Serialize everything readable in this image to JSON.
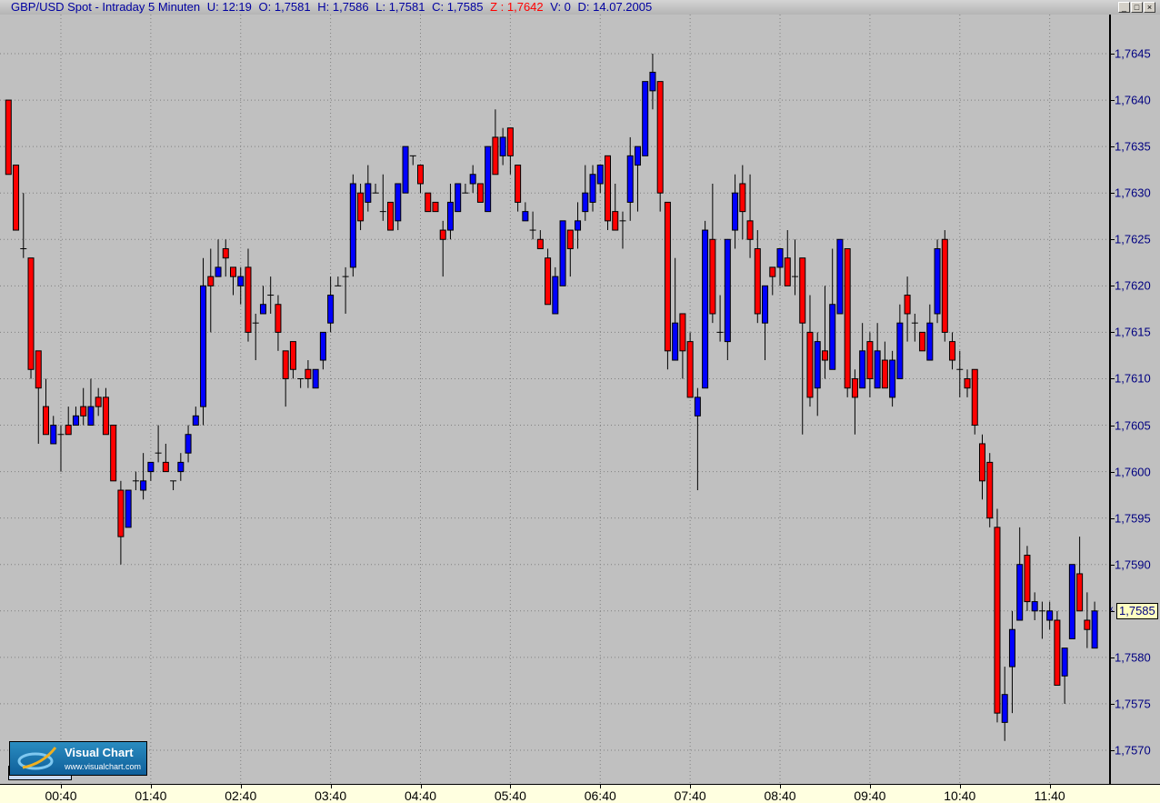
{
  "title_bar": {
    "instrument": "GBP/USD Spot - Intraday 5 Minuten",
    "update": "U: 12:19",
    "open": "O: 1,7581",
    "high": "H: 1,7586",
    "low": "L: 1,7581",
    "close": "C: 1,7585",
    "z": "Z : 1,7642",
    "volume": "V: 0",
    "date": "D: 14.07.2005",
    "minimize": "_",
    "maximize": "□",
    "close_btn": "×"
  },
  "current_price_label": "1,7585",
  "logo": {
    "name": "Visual Chart",
    "url": "www.visualchart.com"
  },
  "colors": {
    "up": "#0000ff",
    "down": "#ff0000",
    "background": "#c0c0c0",
    "axis_text": "#000080",
    "grid": "#808080"
  },
  "chart_data": {
    "type": "candlestick",
    "title": "GBP/USD Spot - Intraday 5 Minuten",
    "ylim": [
      1.75655,
      1.76495
    ],
    "grid": true,
    "y_ticks": [
      {
        "label": "1,7645",
        "value": 1.7645
      },
      {
        "label": "1,7640",
        "value": 1.764
      },
      {
        "label": "1,7635",
        "value": 1.7635
      },
      {
        "label": "1,7630",
        "value": 1.763
      },
      {
        "label": "1,7625",
        "value": 1.7625
      },
      {
        "label": "1,7620",
        "value": 1.762
      },
      {
        "label": "1,7615",
        "value": 1.7615
      },
      {
        "label": "1,7610",
        "value": 1.761
      },
      {
        "label": "1,7605",
        "value": 1.7605
      },
      {
        "label": "1,7600",
        "value": 1.76
      },
      {
        "label": "1,7595",
        "value": 1.7595
      },
      {
        "label": "1,7590",
        "value": 1.759
      },
      {
        "label": "1,7585",
        "value": 1.7585
      },
      {
        "label": "1,7580",
        "value": 1.758
      },
      {
        "label": "1,7575",
        "value": 1.7575
      },
      {
        "label": "1,7570",
        "value": 1.757
      }
    ],
    "x_ticks": [
      {
        "label": "00:40",
        "index": 7
      },
      {
        "label": "01:40",
        "index": 19
      },
      {
        "label": "02:40",
        "index": 31
      },
      {
        "label": "03:40",
        "index": 43
      },
      {
        "label": "04:40",
        "index": 55
      },
      {
        "label": "05:40",
        "index": 67
      },
      {
        "label": "06:40",
        "index": 79
      },
      {
        "label": "07:40",
        "index": 91
      },
      {
        "label": "08:40",
        "index": 103
      },
      {
        "label": "09:40",
        "index": 115
      },
      {
        "label": "10:40",
        "index": 127
      },
      {
        "label": "11:40",
        "index": 139
      }
    ],
    "ohlc_fields": [
      "open",
      "high",
      "low",
      "close"
    ],
    "ohlc": [
      [
        1.764,
        1.764,
        1.7632,
        1.7632
      ],
      [
        1.7633,
        1.7633,
        1.7626,
        1.7626
      ],
      [
        1.7624,
        1.763,
        1.7623,
        1.7624
      ],
      [
        1.7623,
        1.7623,
        1.761,
        1.7611
      ],
      [
        1.7613,
        1.7613,
        1.7603,
        1.7609
      ],
      [
        1.7607,
        1.761,
        1.7604,
        1.7604
      ],
      [
        1.7603,
        1.7606,
        1.7603,
        1.7605
      ],
      [
        1.7604,
        1.7605,
        1.76,
        1.7604
      ],
      [
        1.7605,
        1.7607,
        1.7604,
        1.7604
      ],
      [
        1.7605,
        1.7607,
        1.7605,
        1.7606
      ],
      [
        1.7607,
        1.7609,
        1.7605,
        1.7606
      ],
      [
        1.7605,
        1.761,
        1.7605,
        1.7607
      ],
      [
        1.7608,
        1.7609,
        1.7606,
        1.7607
      ],
      [
        1.7608,
        1.7609,
        1.7604,
        1.7604
      ],
      [
        1.7605,
        1.7605,
        1.7599,
        1.7599
      ],
      [
        1.7598,
        1.7599,
        1.759,
        1.7593
      ],
      [
        1.7594,
        1.7598,
        1.7594,
        1.7598
      ],
      [
        1.7599,
        1.76,
        1.7598,
        1.7599
      ],
      [
        1.7598,
        1.7602,
        1.7597,
        1.7599
      ],
      [
        1.76,
        1.7601,
        1.7599,
        1.7601
      ],
      [
        1.7602,
        1.7605,
        1.7601,
        1.7602
      ],
      [
        1.7601,
        1.7603,
        1.76,
        1.76
      ],
      [
        1.7599,
        1.7599,
        1.7598,
        1.7599
      ],
      [
        1.76,
        1.7602,
        1.7599,
        1.7601
      ],
      [
        1.7602,
        1.7605,
        1.7601,
        1.7604
      ],
      [
        1.7605,
        1.7607,
        1.7605,
        1.7606
      ],
      [
        1.7607,
        1.7623,
        1.7605,
        1.762
      ],
      [
        1.7621,
        1.7624,
        1.7615,
        1.762
      ],
      [
        1.7621,
        1.7625,
        1.7621,
        1.7622
      ],
      [
        1.7624,
        1.7625,
        1.7621,
        1.7623
      ],
      [
        1.7622,
        1.7622,
        1.7619,
        1.7621
      ],
      [
        1.762,
        1.7622,
        1.7618,
        1.7621
      ],
      [
        1.7622,
        1.7624,
        1.7614,
        1.7615
      ],
      [
        1.7616,
        1.7617,
        1.7612,
        1.7616
      ],
      [
        1.7617,
        1.762,
        1.7617,
        1.7618
      ],
      [
        1.7619,
        1.7621,
        1.7617,
        1.7619
      ],
      [
        1.7618,
        1.7619,
        1.7613,
        1.7615
      ],
      [
        1.7613,
        1.7613,
        1.7607,
        1.761
      ],
      [
        1.7614,
        1.7614,
        1.761,
        1.7611
      ],
      [
        1.761,
        1.761,
        1.7609,
        1.761
      ],
      [
        1.7611,
        1.7612,
        1.7609,
        1.761
      ],
      [
        1.7609,
        1.7611,
        1.7609,
        1.7611
      ],
      [
        1.7612,
        1.7615,
        1.7611,
        1.7615
      ],
      [
        1.7616,
        1.7621,
        1.7615,
        1.7619
      ],
      [
        1.762,
        1.7621,
        1.762,
        1.762
      ],
      [
        1.7621,
        1.7622,
        1.7617,
        1.7621
      ],
      [
        1.7622,
        1.7632,
        1.7621,
        1.7631
      ],
      [
        1.763,
        1.7631,
        1.7626,
        1.7627
      ],
      [
        1.7629,
        1.7633,
        1.7628,
        1.7631
      ],
      [
        1.763,
        1.7631,
        1.763,
        1.763
      ],
      [
        1.7628,
        1.7632,
        1.7627,
        1.7628
      ],
      [
        1.7629,
        1.7629,
        1.7626,
        1.7626
      ],
      [
        1.7627,
        1.7631,
        1.7626,
        1.7631
      ],
      [
        1.763,
        1.7635,
        1.763,
        1.7635
      ],
      [
        1.7634,
        1.7634,
        1.7633,
        1.7634
      ],
      [
        1.7633,
        1.7633,
        1.763,
        1.7631
      ],
      [
        1.763,
        1.763,
        1.7628,
        1.7628
      ],
      [
        1.7629,
        1.7629,
        1.7628,
        1.7628
      ],
      [
        1.7626,
        1.7627,
        1.7621,
        1.7625
      ],
      [
        1.7626,
        1.7631,
        1.7625,
        1.7629
      ],
      [
        1.7628,
        1.7631,
        1.7628,
        1.7631
      ],
      [
        1.763,
        1.7631,
        1.763,
        1.763
      ],
      [
        1.7631,
        1.7633,
        1.763,
        1.7632
      ],
      [
        1.7631,
        1.7631,
        1.7629,
        1.7629
      ],
      [
        1.7628,
        1.7635,
        1.7628,
        1.7635
      ],
      [
        1.7636,
        1.7639,
        1.7632,
        1.7632
      ],
      [
        1.7634,
        1.7637,
        1.7633,
        1.7636
      ],
      [
        1.7637,
        1.7637,
        1.7632,
        1.7634
      ],
      [
        1.7633,
        1.7633,
        1.7628,
        1.7629
      ],
      [
        1.7627,
        1.7629,
        1.7627,
        1.7628
      ],
      [
        1.7626,
        1.7628,
        1.7625,
        1.7626
      ],
      [
        1.7625,
        1.7626,
        1.7624,
        1.7624
      ],
      [
        1.7623,
        1.7624,
        1.7618,
        1.7618
      ],
      [
        1.7617,
        1.7622,
        1.7617,
        1.7621
      ],
      [
        1.762,
        1.7627,
        1.762,
        1.7627
      ],
      [
        1.7626,
        1.7626,
        1.7621,
        1.7624
      ],
      [
        1.7626,
        1.7629,
        1.7624,
        1.7627
      ],
      [
        1.7628,
        1.7633,
        1.7627,
        1.763
      ],
      [
        1.7629,
        1.7633,
        1.7628,
        1.7632
      ],
      [
        1.7631,
        1.7633,
        1.763,
        1.7633
      ],
      [
        1.7634,
        1.7634,
        1.7626,
        1.7627
      ],
      [
        1.7628,
        1.7631,
        1.7626,
        1.7626
      ],
      [
        1.7627,
        1.7628,
        1.7624,
        1.7627
      ],
      [
        1.7629,
        1.7636,
        1.7627,
        1.7634
      ],
      [
        1.7633,
        1.7635,
        1.7628,
        1.7635
      ],
      [
        1.7634,
        1.7642,
        1.7634,
        1.7642
      ],
      [
        1.7641,
        1.7645,
        1.7639,
        1.7643
      ],
      [
        1.7642,
        1.7642,
        1.7628,
        1.763
      ],
      [
        1.7629,
        1.7629,
        1.7611,
        1.7613
      ],
      [
        1.7612,
        1.7623,
        1.7612,
        1.7616
      ],
      [
        1.7617,
        1.7617,
        1.761,
        1.7613
      ],
      [
        1.7614,
        1.7615,
        1.7608,
        1.7608
      ],
      [
        1.7606,
        1.7609,
        1.7598,
        1.7608
      ],
      [
        1.7609,
        1.7627,
        1.7609,
        1.7626
      ],
      [
        1.7625,
        1.7631,
        1.7616,
        1.7617
      ],
      [
        1.7615,
        1.7619,
        1.7614,
        1.7615
      ],
      [
        1.7614,
        1.7625,
        1.7612,
        1.7625
      ],
      [
        1.7626,
        1.7632,
        1.7624,
        1.763
      ],
      [
        1.7631,
        1.7633,
        1.7625,
        1.7628
      ],
      [
        1.7627,
        1.7632,
        1.7623,
        1.7625
      ],
      [
        1.7624,
        1.7626,
        1.7616,
        1.7617
      ],
      [
        1.7616,
        1.762,
        1.7612,
        1.762
      ],
      [
        1.7622,
        1.7622,
        1.7619,
        1.7621
      ],
      [
        1.7622,
        1.7624,
        1.762,
        1.7624
      ],
      [
        1.7623,
        1.7626,
        1.762,
        1.762
      ],
      [
        1.7621,
        1.7625,
        1.7619,
        1.7621
      ],
      [
        1.7623,
        1.7623,
        1.7604,
        1.7616
      ],
      [
        1.7615,
        1.7619,
        1.7607,
        1.7608
      ],
      [
        1.7609,
        1.7615,
        1.7606,
        1.7614
      ],
      [
        1.7613,
        1.762,
        1.761,
        1.7612
      ],
      [
        1.7611,
        1.7624,
        1.7611,
        1.7618
      ],
      [
        1.7617,
        1.7625,
        1.7617,
        1.7625
      ],
      [
        1.7624,
        1.7624,
        1.7608,
        1.7609
      ],
      [
        1.761,
        1.7611,
        1.7604,
        1.7608
      ],
      [
        1.7609,
        1.7616,
        1.7609,
        1.7613
      ],
      [
        1.7614,
        1.7615,
        1.7608,
        1.761
      ],
      [
        1.7609,
        1.7616,
        1.7609,
        1.7613
      ],
      [
        1.7612,
        1.7614,
        1.7609,
        1.7609
      ],
      [
        1.7608,
        1.7613,
        1.7607,
        1.7612
      ],
      [
        1.761,
        1.7618,
        1.761,
        1.7616
      ],
      [
        1.7619,
        1.7621,
        1.7614,
        1.7617
      ],
      [
        1.7616,
        1.7617,
        1.7614,
        1.7616
      ],
      [
        1.7615,
        1.7615,
        1.7613,
        1.7613
      ],
      [
        1.7612,
        1.7618,
        1.7612,
        1.7616
      ],
      [
        1.7617,
        1.7625,
        1.7616,
        1.7624
      ],
      [
        1.7625,
        1.7626,
        1.7614,
        1.7615
      ],
      [
        1.7614,
        1.7615,
        1.7611,
        1.7612
      ],
      [
        1.7611,
        1.7613,
        1.7608,
        1.7611
      ],
      [
        1.761,
        1.7611,
        1.7608,
        1.7609
      ],
      [
        1.7611,
        1.7611,
        1.7604,
        1.7605
      ],
      [
        1.7603,
        1.7604,
        1.7597,
        1.7599
      ],
      [
        1.7601,
        1.7602,
        1.7594,
        1.7595
      ],
      [
        1.7594,
        1.7596,
        1.7573,
        1.7574
      ],
      [
        1.7573,
        1.7579,
        1.7571,
        1.7576
      ],
      [
        1.7579,
        1.7585,
        1.7574,
        1.7583
      ],
      [
        1.7584,
        1.7594,
        1.7584,
        1.759
      ],
      [
        1.7591,
        1.7592,
        1.7585,
        1.7586
      ],
      [
        1.7585,
        1.7587,
        1.7584,
        1.7586
      ],
      [
        1.7585,
        1.7586,
        1.7582,
        1.7585
      ],
      [
        1.7584,
        1.7586,
        1.7583,
        1.7585
      ],
      [
        1.7584,
        1.7585,
        1.7577,
        1.7577
      ],
      [
        1.7578,
        1.7581,
        1.7575,
        1.7581
      ],
      [
        1.7582,
        1.759,
        1.7582,
        1.759
      ],
      [
        1.7589,
        1.7593,
        1.7585,
        1.7585
      ],
      [
        1.7584,
        1.7587,
        1.7581,
        1.7583
      ],
      [
        1.7581,
        1.7586,
        1.7581,
        1.7585
      ]
    ],
    "current_price": 1.7585
  }
}
